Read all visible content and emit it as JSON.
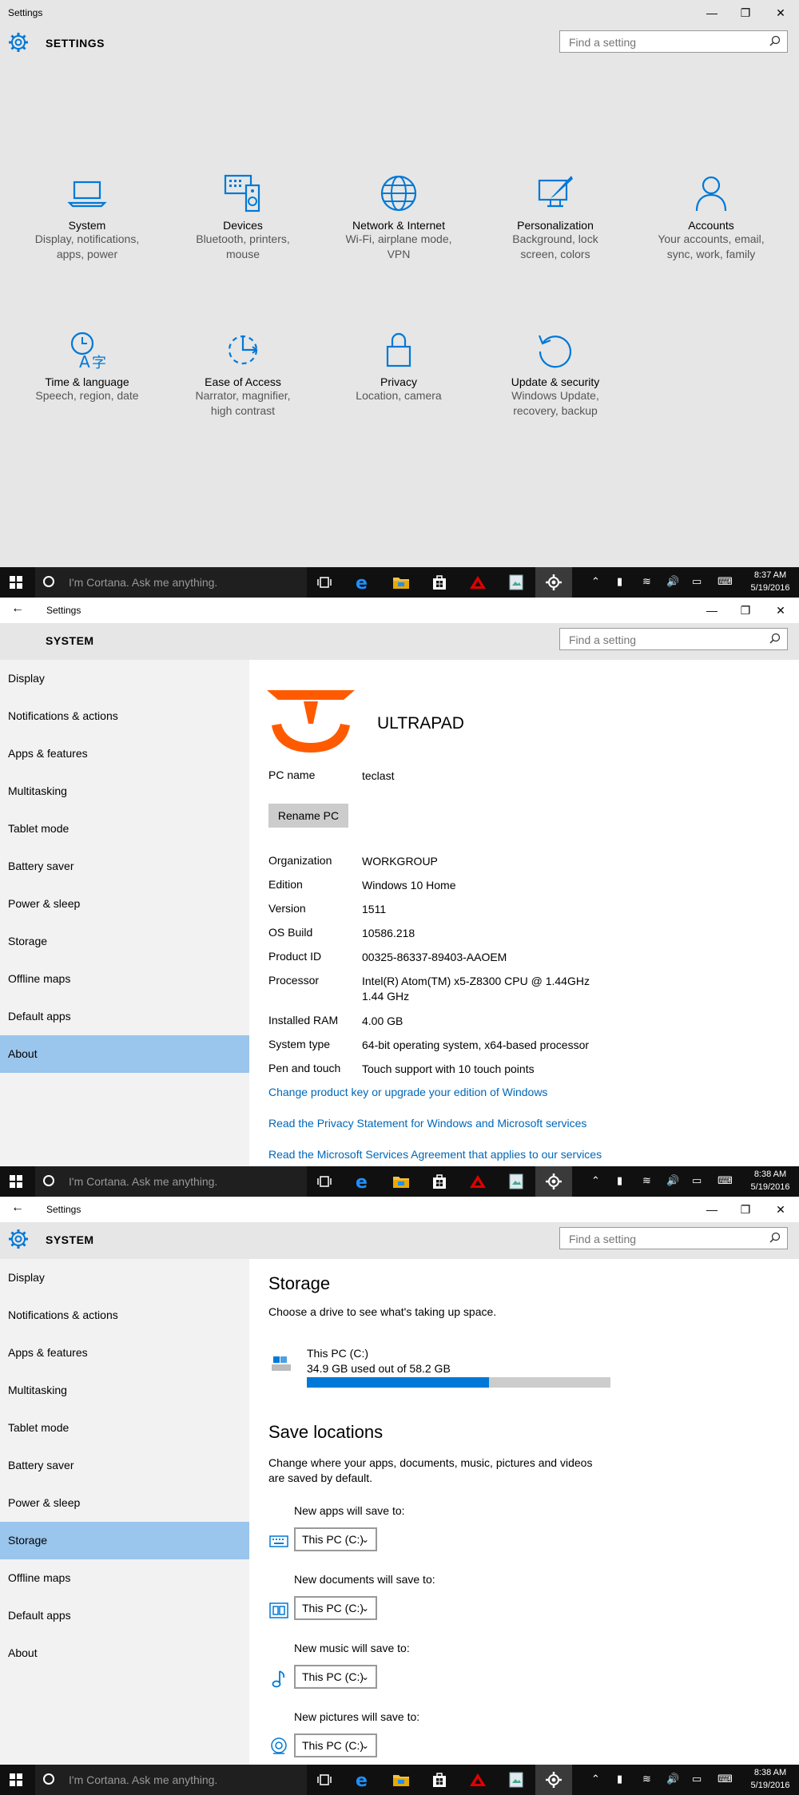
{
  "colors": {
    "accent": "#0078d7",
    "selected_nav": "#9ac5ec",
    "link": "#0067b8",
    "logo": "#ff5a00"
  },
  "screen1": {
    "window_title": "Settings",
    "header_title": "SETTINGS",
    "search_placeholder": "Find a setting",
    "categories": [
      {
        "icon": "laptop-icon",
        "name": "System",
        "desc1": "Display, notifications,",
        "desc2": "apps, power"
      },
      {
        "icon": "devices-icon",
        "name": "Devices",
        "desc1": "Bluetooth, printers,",
        "desc2": "mouse"
      },
      {
        "icon": "globe-icon",
        "name": "Network & Internet",
        "desc1": "Wi-Fi, airplane mode,",
        "desc2": "VPN"
      },
      {
        "icon": "personalization-icon",
        "name": "Personalization",
        "desc1": "Background, lock",
        "desc2": "screen, colors"
      },
      {
        "icon": "person-icon",
        "name": "Accounts",
        "desc1": "Your accounts, email,",
        "desc2": "sync, work, family"
      },
      {
        "icon": "time-language-icon",
        "name": "Time & language",
        "desc1": "Speech, region, date",
        "desc2": ""
      },
      {
        "icon": "ease-of-access-icon",
        "name": "Ease of Access",
        "desc1": "Narrator, magnifier,",
        "desc2": "high contrast"
      },
      {
        "icon": "lock-icon",
        "name": "Privacy",
        "desc1": "Location, camera",
        "desc2": ""
      },
      {
        "icon": "update-icon",
        "name": "Update & security",
        "desc1": "Windows Update,",
        "desc2": "recovery, backup"
      }
    ]
  },
  "taskbars": [
    {
      "cortana": "I'm Cortana. Ask me anything.",
      "time": "8:37 AM",
      "date": "5/19/2016"
    },
    {
      "cortana": "I'm Cortana. Ask me anything.",
      "time": "8:38 AM",
      "date": "5/19/2016"
    },
    {
      "cortana": "I'm Cortana. Ask me anything.",
      "time": "8:38 AM",
      "date": "5/19/2016"
    }
  ],
  "nav": [
    "Display",
    "Notifications & actions",
    "Apps & features",
    "Multitasking",
    "Tablet mode",
    "Battery saver",
    "Power & sleep",
    "Storage",
    "Offline maps",
    "Default apps",
    "About"
  ],
  "screen2": {
    "window_title": "Settings",
    "header_title": "SYSTEM",
    "search_placeholder": "Find a setting",
    "selected_nav": "About",
    "brand": "ULTRAPAD",
    "pc_name_label": "PC name",
    "pc_name": "teclast",
    "rename_button": "Rename PC",
    "props": [
      {
        "k": "Organization",
        "v": "WORKGROUP"
      },
      {
        "k": "Edition",
        "v": "Windows 10 Home"
      },
      {
        "k": "Version",
        "v": "1511"
      },
      {
        "k": "OS Build",
        "v": "10586.218"
      },
      {
        "k": "Product ID",
        "v": "00325-86337-89403-AAOEM"
      },
      {
        "k": "Processor",
        "v": "Intel(R) Atom(TM) x5-Z8300  CPU @ 1.44GHz",
        "v2": "1.44 GHz"
      },
      {
        "k": "Installed RAM",
        "v": "4.00 GB"
      },
      {
        "k": "System type",
        "v": "64-bit operating system, x64-based processor"
      },
      {
        "k": "Pen and touch",
        "v": "Touch support with 10 touch points"
      }
    ],
    "links": [
      "Change product key or upgrade your edition of Windows",
      "Read the Privacy Statement for Windows and Microsoft services",
      "Read the Microsoft Services Agreement that applies to our services"
    ]
  },
  "screen3": {
    "window_title": "Settings",
    "header_title": "SYSTEM",
    "search_placeholder": "Find a setting",
    "selected_nav": "Storage",
    "storage_title": "Storage",
    "storage_desc": "Choose a drive to see what's taking up space.",
    "drive_name": "This PC (C:)",
    "drive_usage": "34.9 GB used out of 58.2 GB",
    "used_fraction": 0.6,
    "save_title": "Save locations",
    "save_desc1": "Change where your apps, documents, music, pictures and videos",
    "save_desc2": "are saved by default.",
    "locations": [
      {
        "icon": "keyboard-icon",
        "label": "New apps will save to:",
        "value": "This PC (C:)"
      },
      {
        "icon": "documents-icon",
        "label": "New documents will save to:",
        "value": "This PC (C:)"
      },
      {
        "icon": "music-note-icon",
        "label": "New music will save to:",
        "value": "This PC (C:)"
      },
      {
        "icon": "camera-icon",
        "label": "New pictures will save to:",
        "value": "This PC (C:)"
      }
    ]
  }
}
